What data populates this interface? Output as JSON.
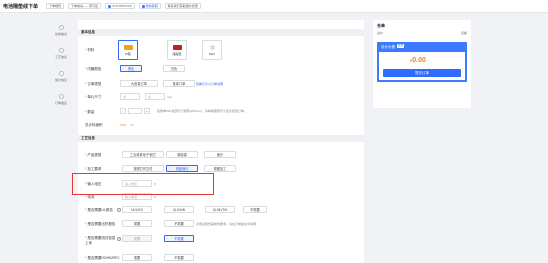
{
  "topbar": {
    "title": "电池隔垫线下单",
    "chips": [
      "下单规则",
      "下单前请——萧与您",
      "4771756XXXX",
      "微信客服",
      "联系我们获取报价优惠"
    ]
  },
  "leftnav": {
    "items": [
      "基本信息",
      "工艺信息",
      "加价信息",
      "订单备注"
    ]
  },
  "basic": {
    "section_title": "基本信息",
    "material_label": "材料",
    "materials": [
      {
        "label": "PI膜",
        "color": "#f0a020"
      },
      {
        "label": "硅胶垫",
        "color": "#b52323"
      },
      {
        "label": "PET",
        "color": "#dcdcdc"
      }
    ],
    "colors_label": "内膜颜色",
    "color_opts": [
      "黑色",
      "白色"
    ],
    "order_type_label": "订单类型",
    "order_type_opts": [
      "大批量订单",
      "批量订单"
    ],
    "order_type_link": "查看与大小订单说明",
    "size_label": "单片尺寸",
    "size_x_placeholder": "长",
    "size_y_placeholder": "宽",
    "size_unit": "mm",
    "qty_label": "数量",
    "qty_minus": "-",
    "qty_plus": "+",
    "qty_note": "如果单PET板因尺寸按照(200mm)，请单独按照尺寸最为批量订单。",
    "area_label": "总计料面积",
    "area_value": "0.00",
    "area_unit": "m²"
  },
  "process": {
    "section_title": "工艺信息",
    "product_type_label": "产品类型",
    "product_type_opts": [
      "工业消费电子/其它",
      "新能源",
      "医疗"
    ],
    "process_req_label": "加工要求",
    "process_req_opts": [
      "按需打印文件",
      "按图裁切",
      "按图加工"
    ],
    "input_voltage_label": "输入电压",
    "input_voltage_placeholder": "输入电压",
    "voltage_unit": "V",
    "current_label": "电流",
    "current_placeholder": "输入电流",
    "current_unit": "A",
    "ul_label": "是否需要UL报告",
    "ul_opts": [
      "UL94V0",
      "UL94HB",
      "UL94VTM",
      "不需要"
    ],
    "coc_label": "是否需要出货报告",
    "coc_opts": [
      "需要",
      "不需要"
    ],
    "coc_note": "对测试报告需求的要求，请在订单备注中说明",
    "test_label": "是否需要测试信息上传",
    "test_opts": [
      "需要",
      "不需要"
    ],
    "rohs_label": "是否需要ROHS/RFC",
    "rohs_opts": [
      "需要",
      "不需要"
    ]
  },
  "summary": {
    "title": "合单",
    "sub_left": "总价",
    "sub_right": "包邮",
    "price_title": "设计价格",
    "price_badge": "优惠",
    "currency": "¥",
    "price": "0.00",
    "submit": "提交订单"
  }
}
